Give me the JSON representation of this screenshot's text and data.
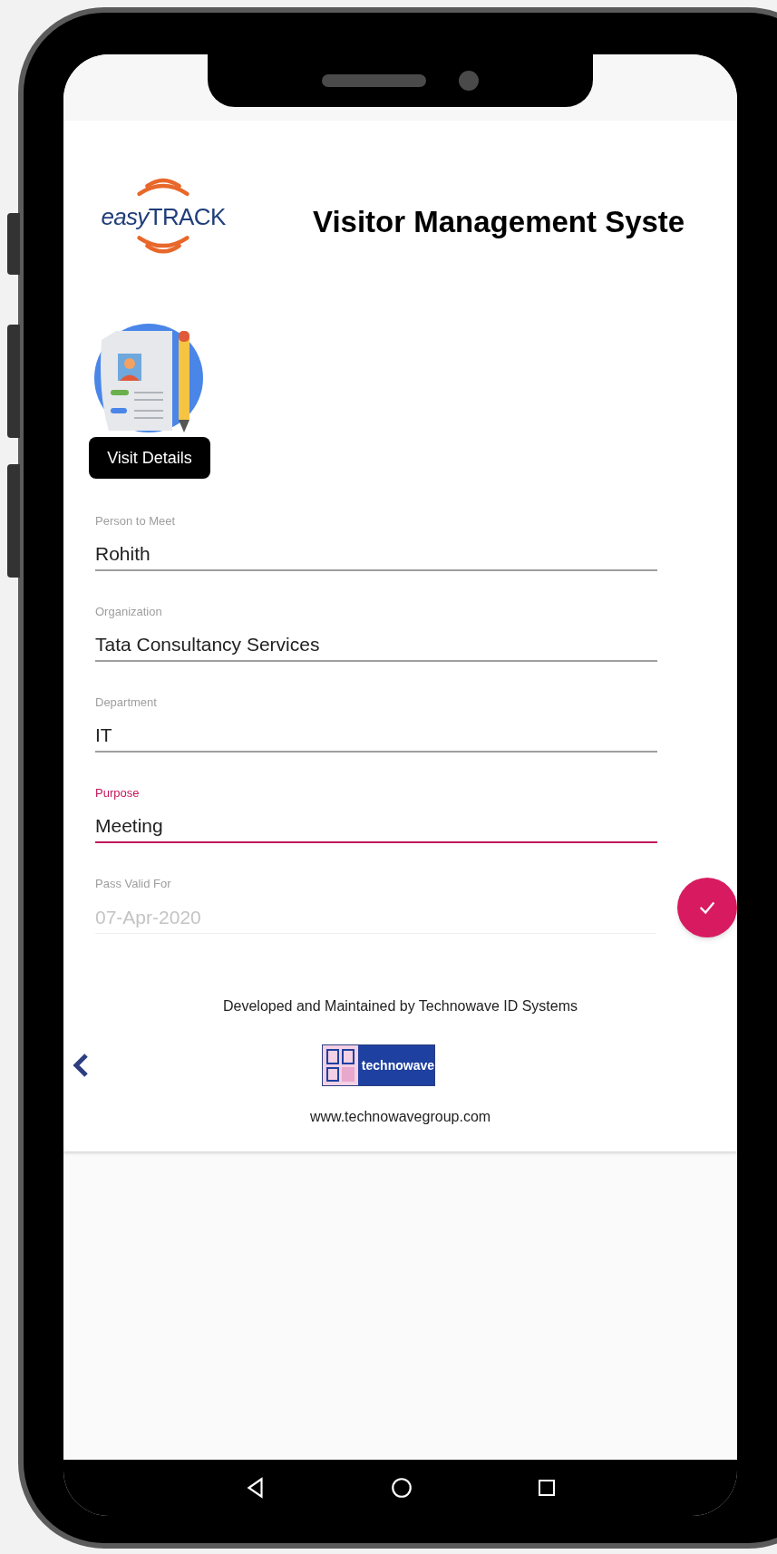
{
  "header": {
    "logo_prefix": "easy",
    "logo_text": "TRACK",
    "title": "Visitor Management Syste"
  },
  "section": {
    "label": "Visit Details"
  },
  "fields": [
    {
      "label": "Person to Meet",
      "value": "Rohith",
      "focused": false,
      "disabled": false
    },
    {
      "label": "Organization",
      "value": "Tata Consultancy Services",
      "focused": false,
      "disabled": false
    },
    {
      "label": "Department",
      "value": "IT",
      "focused": false,
      "disabled": false
    },
    {
      "label": "Purpose",
      "value": "Meeting",
      "focused": true,
      "disabled": false
    },
    {
      "label": "Pass Valid For",
      "value": "07-Apr-2020",
      "focused": false,
      "disabled": true
    }
  ],
  "footer": {
    "credit": "Developed and Maintained by Technowave ID Systems",
    "logo_text": "technowave",
    "website": "www.technowavegroup.com"
  }
}
